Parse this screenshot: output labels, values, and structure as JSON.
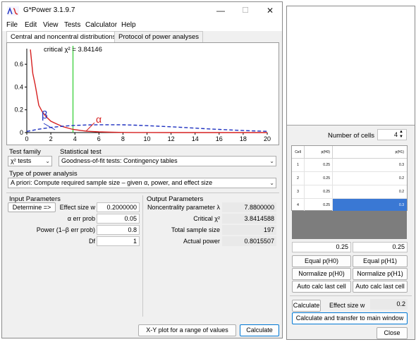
{
  "main": {
    "title": "G*Power 3.1.9.7",
    "window_controls": {
      "minimize": "—",
      "maximize": "☐",
      "close": "✕"
    },
    "menu": [
      "File",
      "Edit",
      "View",
      "Tests",
      "Calculator",
      "Help"
    ],
    "tabs": [
      "Central and noncentral distributions",
      "Protocol of power analyses"
    ],
    "plot": {
      "critical_label": "critical χ² = 3.84146",
      "beta_label": "β",
      "alpha_label": "α"
    },
    "test_family": {
      "label": "Test family",
      "value": "χ² tests"
    },
    "statistical_test": {
      "label": "Statistical test",
      "value": "Goodness-of-fit tests: Contingency tables"
    },
    "power_analysis": {
      "label": "Type of power analysis",
      "value": "A priori: Compute required sample size – given α, power, and effect size"
    },
    "input": {
      "heading": "Input Parameters",
      "determine_button": "Determine =>",
      "effect_size_label": "Effect size w",
      "effect_size_value": "0.2000000",
      "alpha_label": "α err prob",
      "alpha_value": "0.05",
      "power_label": "Power (1–β err prob)",
      "power_value": "0.8",
      "df_label": "Df",
      "df_value": "1"
    },
    "output": {
      "heading": "Output Parameters",
      "noncentrality_label": "Noncentrality parameter λ",
      "noncentrality_value": "7.8800000",
      "critical_label": "Critical χ²",
      "critical_value": "3.8414588",
      "sample_size_label": "Total sample size",
      "sample_size_value": "197",
      "power_label": "Actual power",
      "power_value": "0.8015507"
    },
    "xy_plot_button": "X-Y plot for a range of values",
    "calculate_button": "Calculate"
  },
  "chart_data": {
    "type": "line",
    "x_ticks": [
      "0",
      "2",
      "4",
      "6",
      "8",
      "10",
      "12",
      "14",
      "16",
      "18",
      "20"
    ],
    "y_ticks": [
      "0",
      "0.2",
      "0.4",
      "0.6"
    ],
    "xlim": [
      0,
      20
    ],
    "ylim": [
      0,
      0.7
    ],
    "critical_x": 3.84146,
    "series": [
      {
        "color": "#d62020",
        "style": "solid",
        "x": [
          0.3,
          0.5,
          0.7,
          1.0,
          1.3,
          1.6,
          2.0,
          2.5,
          3.0,
          3.5,
          3.84,
          4.5,
          5.0,
          6.0,
          7.0,
          8.0,
          9.0,
          10.0,
          12.0,
          14.0,
          16.0,
          18.0,
          20.0
        ],
        "y": [
          0.73,
          0.52,
          0.42,
          0.24,
          0.18,
          0.14,
          0.1,
          0.075,
          0.052,
          0.037,
          0.028,
          0.018,
          0.012,
          0.006,
          0.003,
          0.0015,
          0.0008,
          0.0004,
          0.0001,
          0.0,
          0.0,
          0.0,
          0.0
        ]
      },
      {
        "color": "#1c2fbf",
        "style": "dashed",
        "x": [
          0,
          1,
          2,
          3,
          4,
          5,
          6,
          7,
          8,
          9,
          10,
          11,
          12,
          13,
          14,
          15,
          16,
          17,
          18,
          19,
          20
        ],
        "y": [
          0.01,
          0.03,
          0.045,
          0.056,
          0.063,
          0.067,
          0.069,
          0.069,
          0.068,
          0.065,
          0.061,
          0.056,
          0.051,
          0.045,
          0.039,
          0.033,
          0.028,
          0.023,
          0.018,
          0.014,
          0.011
        ]
      }
    ]
  },
  "side": {
    "number_of_cells_label": "Number of cells",
    "number_of_cells_value": "4",
    "table": {
      "headers": [
        "Cell",
        "p(H0)",
        "p(H1)"
      ],
      "rows": [
        [
          "1",
          "0.25",
          "0.3"
        ],
        [
          "2",
          "0.25",
          "0.2"
        ],
        [
          "3",
          "0.25",
          "0.2"
        ],
        [
          "4",
          "0.25",
          "0.3"
        ]
      ]
    },
    "sum_h0": "0.25",
    "sum_h1": "0.25",
    "equal_h0_button": "Equal p(H0)",
    "equal_h1_button": "Equal p(H1)",
    "normalize_h0_button": "Normalize p(H0)",
    "normalize_h1_button": "Normalize p(H1)",
    "auto_calc_h0_button": "Auto calc last cell",
    "auto_calc_h1_button": "Auto calc last cell",
    "calculate_button": "Calculate",
    "effect_size_label": "Effect size w",
    "effect_size_value": "0.2",
    "transfer_button": "Calculate and transfer to main window",
    "close_button": "Close"
  }
}
